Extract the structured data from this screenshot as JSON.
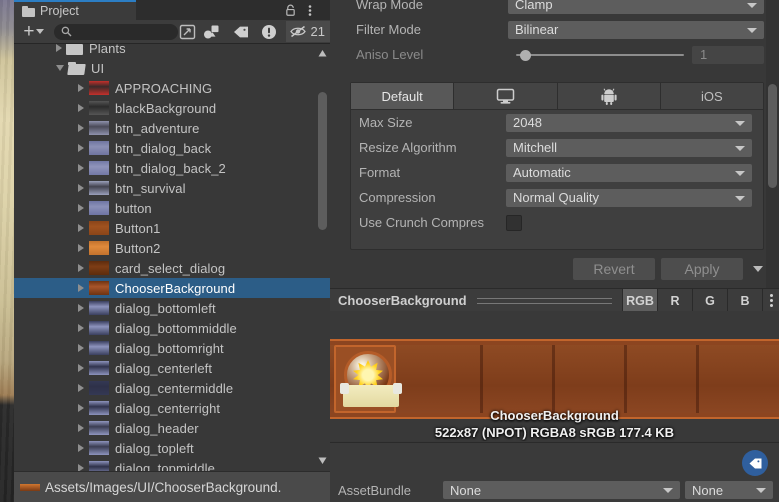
{
  "project_panel": {
    "tab_label": "Project",
    "icons": {
      "folder": "folder-icon",
      "lock": "lock-icon",
      "menu": "kebab-menu-icon"
    },
    "toolbar": {
      "create_label": "+",
      "search_placeholder": "",
      "search_value": "",
      "icons": [
        "search-icon",
        "save-search-icon",
        "asset-type-filter-icon",
        "label-filter-icon",
        "warning-filter-icon",
        "hidden-packages-icon"
      ],
      "hidden_count": "21"
    },
    "tree": [
      {
        "label": "Plants",
        "indent": 1,
        "kind": "folder",
        "expanded": false,
        "selected": false
      },
      {
        "label": "UI",
        "indent": 1,
        "kind": "folder-open",
        "expanded": true,
        "selected": false
      },
      {
        "label": "APPROACHING",
        "indent": 2,
        "kind": "texture",
        "color": "#3a2a2a",
        "accent": "#c4302b",
        "selected": false
      },
      {
        "label": "blackBackground",
        "indent": 2,
        "kind": "texture",
        "color": "#2b2b2b",
        "accent": "#555555",
        "selected": false
      },
      {
        "label": "btn_adventure",
        "indent": 2,
        "kind": "texture",
        "color": "#4a4a58",
        "accent": "#8f92ad",
        "selected": false
      },
      {
        "label": "btn_dialog_back",
        "indent": 2,
        "kind": "texture",
        "color": "#8c90b5",
        "accent": "#6f74a0",
        "selected": false
      },
      {
        "label": "btn_dialog_back_2",
        "indent": 2,
        "kind": "texture",
        "color": "#9094bb",
        "accent": "#7278a6",
        "selected": false
      },
      {
        "label": "btn_survival",
        "indent": 2,
        "kind": "texture",
        "color": "#43434f",
        "accent": "#9aa0bb",
        "selected": false
      },
      {
        "label": "button",
        "indent": 2,
        "kind": "texture",
        "color": "#8b90b8",
        "accent": "#6e74a4",
        "selected": false
      },
      {
        "label": "Button1",
        "indent": 2,
        "kind": "texture",
        "color": "#a0521f",
        "accent": "#8a4519",
        "selected": false
      },
      {
        "label": "Button2",
        "indent": 2,
        "kind": "texture",
        "color": "#e08a3c",
        "accent": "#c2722d",
        "selected": false
      },
      {
        "label": "card_select_dialog",
        "indent": 2,
        "kind": "texture",
        "color": "#7d3d15",
        "accent": "#5d2c0d",
        "selected": false
      },
      {
        "label": "ChooserBackground",
        "indent": 2,
        "kind": "texture",
        "color": "#a8552a",
        "accent": "#6e3312",
        "selected": true
      },
      {
        "label": "dialog_bottomleft",
        "indent": 2,
        "kind": "texture",
        "color": "#8d93bd",
        "accent": "#3a3f5e",
        "selected": false
      },
      {
        "label": "dialog_bottommiddle",
        "indent": 2,
        "kind": "texture",
        "color": "#8d93bd",
        "accent": "#3a3f5e",
        "selected": false
      },
      {
        "label": "dialog_bottomright",
        "indent": 2,
        "kind": "texture",
        "color": "#8d93bd",
        "accent": "#3a3f5e",
        "selected": false
      },
      {
        "label": "dialog_centerleft",
        "indent": 2,
        "kind": "texture",
        "color": "#30334d",
        "accent": "#8d93bd",
        "selected": false
      },
      {
        "label": "dialog_centermiddle",
        "indent": 2,
        "kind": "texture",
        "color": "#2e3149",
        "accent": "#343854",
        "selected": false
      },
      {
        "label": "dialog_centerright",
        "indent": 2,
        "kind": "texture",
        "color": "#30334d",
        "accent": "#8d93bd",
        "selected": false
      },
      {
        "label": "dialog_header",
        "indent": 2,
        "kind": "texture",
        "color": "#3a3d52",
        "accent": "#9096bf",
        "selected": false
      },
      {
        "label": "dialog_topleft",
        "indent": 2,
        "kind": "texture",
        "color": "#3a3d52",
        "accent": "#8d93bd",
        "selected": false
      },
      {
        "label": "dialog_topmiddle",
        "indent": 2,
        "kind": "texture",
        "color": "#2e3149",
        "accent": "#8d93bd",
        "selected": false
      }
    ],
    "status_path": "Assets/Images/UI/ChooserBackground."
  },
  "inspector": {
    "properties": [
      {
        "label": "Wrap Mode",
        "value": "Clamp",
        "type": "dropdown",
        "dim": false
      },
      {
        "label": "Filter Mode",
        "value": "Bilinear",
        "type": "dropdown",
        "dim": false
      },
      {
        "label": "Aniso Level",
        "value": "1",
        "type": "slider",
        "dim": true
      }
    ],
    "platform_tabs": [
      {
        "label": "Default",
        "icon": "",
        "active": true
      },
      {
        "label": "",
        "icon": "standalone-monitor-icon",
        "active": false
      },
      {
        "label": "",
        "icon": "android-robot-icon",
        "active": false
      },
      {
        "label": "iOS",
        "icon": "",
        "active": false
      }
    ],
    "platform_props": [
      {
        "label": "Max Size",
        "value": "2048",
        "type": "dropdown"
      },
      {
        "label": "Resize Algorithm",
        "value": "Mitchell",
        "type": "dropdown"
      },
      {
        "label": "Format",
        "value": "Automatic",
        "type": "dropdown"
      },
      {
        "label": "Compression",
        "value": "Normal Quality",
        "type": "dropdown"
      },
      {
        "label": "Use Crunch Compres",
        "value": "",
        "type": "checkbox",
        "checked": false
      }
    ],
    "revert_label": "Revert",
    "apply_label": "Apply",
    "preview_bar": {
      "title": "ChooserBackground",
      "channels": [
        "RGB",
        "R",
        "G",
        "B"
      ],
      "active_channel": "RGB",
      "menu_icon": "kebab-menu-icon"
    },
    "preview": {
      "caption": "ChooserBackground",
      "details": "522x87 (NPOT)  RGBA8 sRGB  177.4 KB"
    },
    "asset_bundle": {
      "label": "AssetBundle",
      "bundle_value": "None",
      "variant_value": "None",
      "tag_icon": "label-tag-icon"
    }
  },
  "colors": {
    "selection": "#2c5d87",
    "tab_accent": "#2c7ec4",
    "panel_bg": "#383838",
    "toolbar_bg": "#3c3c3c",
    "field_bg": "#5d5d5d",
    "tag_button": "#2f5f9e"
  }
}
